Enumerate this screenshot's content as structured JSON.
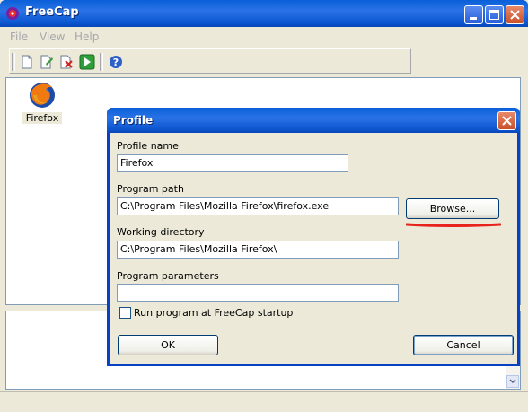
{
  "window": {
    "title": "FreeCap"
  },
  "menu": {
    "items": [
      "File",
      "View",
      "Help"
    ]
  },
  "toolbar": {
    "icons": [
      "new-profile-icon",
      "edit-profile-icon",
      "delete-profile-icon",
      "run-icon",
      "help-icon"
    ]
  },
  "profiles": [
    {
      "label": "Firefox",
      "icon": "firefox-icon"
    }
  ],
  "dialog": {
    "title": "Profile",
    "profile_name_label": "Profile name",
    "profile_name_value": "Firefox",
    "program_path_label": "Program path",
    "program_path_value": "C:\\Program Files\\Mozilla Firefox\\firefox.exe",
    "browse_label": "Browse...",
    "working_dir_label": "Working directory",
    "working_dir_value": "C:\\Program Files\\Mozilla Firefox\\",
    "params_label": "Program parameters",
    "params_value": "",
    "startup_checkbox_label": "Run program at FreeCap startup",
    "startup_checked": false,
    "ok_label": "OK",
    "cancel_label": "Cancel"
  },
  "colors": {
    "titlebar": "#0A5FD8",
    "annotation": "#E8231B",
    "face": "#ECE9D8"
  }
}
